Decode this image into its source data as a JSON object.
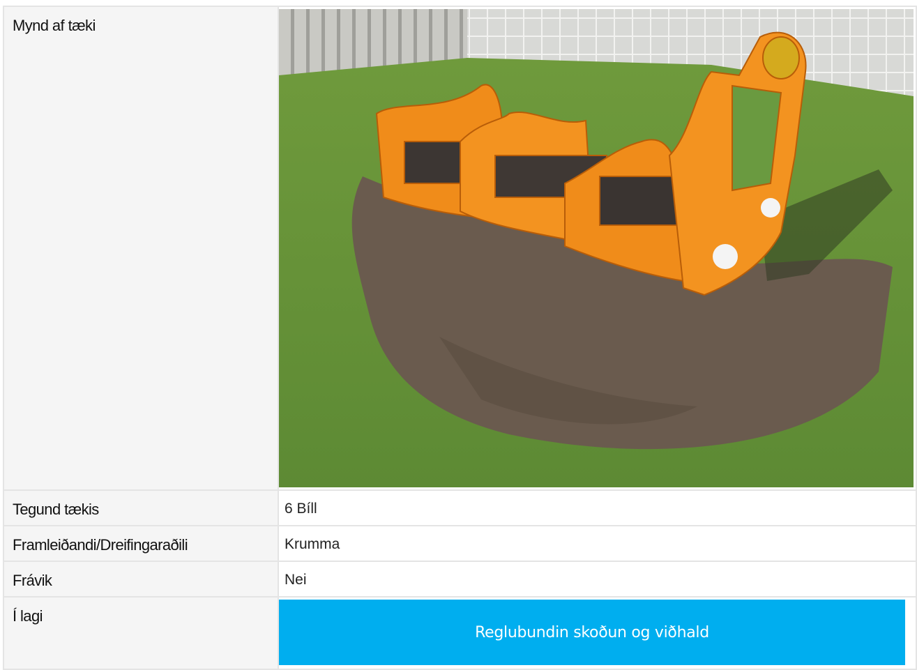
{
  "rows": [
    {
      "label": "Mynd af tæki",
      "photo_alt": "Orange playground train equipment on grass"
    },
    {
      "label": "Tegund tækis",
      "value": "6 Bíll"
    },
    {
      "label": "Framleiðandi/Dreifingaraðili",
      "value": "Krumma"
    },
    {
      "label": "Frávik",
      "value": "Nei"
    },
    {
      "label": "Í lagi",
      "button_label": "Reglubundin skoðun og viðhald"
    }
  ],
  "colors": {
    "button": "#00aeef",
    "label_bg": "#f5f5f5",
    "border": "#e4e4e4"
  }
}
